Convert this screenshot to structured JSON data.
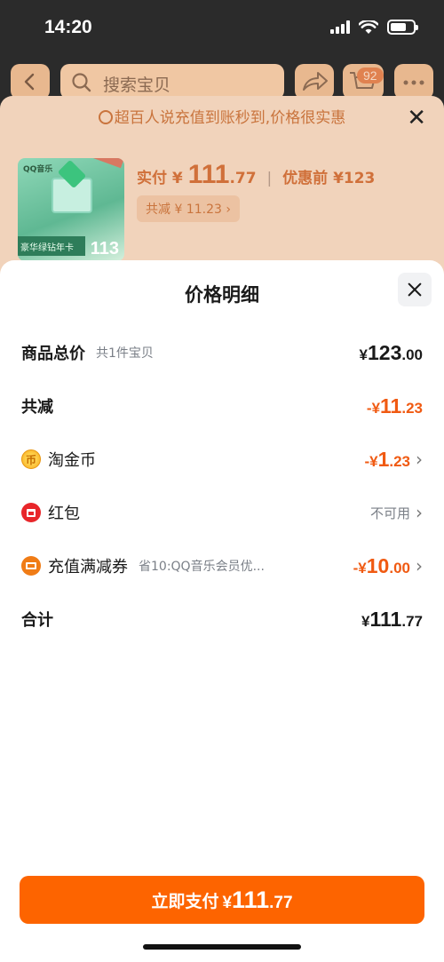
{
  "status_bar": {
    "time": "14:20"
  },
  "nav": {
    "search_placeholder": "搜索宝贝",
    "cart_count": "92"
  },
  "back_sheet": {
    "notice": "超百人说充值到账秒到,价格很实惠",
    "product_brand": "QQ音乐",
    "product_tag": "豪华绿钻年卡",
    "product_number": "113",
    "paid_label": "实付",
    "paid_currency": "¥",
    "paid_int": "111",
    "paid_dec": ".77",
    "before_label": "优惠前",
    "before_amount": "¥123",
    "discount_text": "共减 ¥ 11.23"
  },
  "sheet": {
    "title": "价格明细",
    "rows": {
      "total": {
        "label": "商品总价",
        "sub": "共1件宝贝",
        "prefix": "¥",
        "int": "123",
        "dec": ".00"
      },
      "reduced": {
        "label": "共减",
        "prefix": "-¥",
        "int": "11",
        "dec": ".23"
      },
      "coins": {
        "label": "淘金币",
        "prefix": "-¥",
        "int": "1",
        "dec": ".23"
      },
      "redpacket": {
        "label": "红包",
        "status": "不可用"
      },
      "coupon": {
        "label": "充值满减券",
        "sub": "省10:QQ音乐会员优...",
        "prefix": "-¥",
        "int": "10",
        "dec": ".00"
      },
      "sum": {
        "label": "合计",
        "prefix": "¥",
        "int": "111",
        "dec": ".77"
      }
    }
  },
  "pay_button": {
    "label": "立即支付",
    "currency": "¥",
    "int": "111",
    "dec": ".77"
  },
  "colors": {
    "accent": "#fd6400",
    "discount": "#f05a12"
  },
  "icons": [
    "back-icon",
    "search-icon",
    "share-icon",
    "cart-icon",
    "more-icon",
    "close-icon",
    "coin-icon",
    "red-packet-icon",
    "coupon-icon",
    "chevron-right-icon"
  ]
}
